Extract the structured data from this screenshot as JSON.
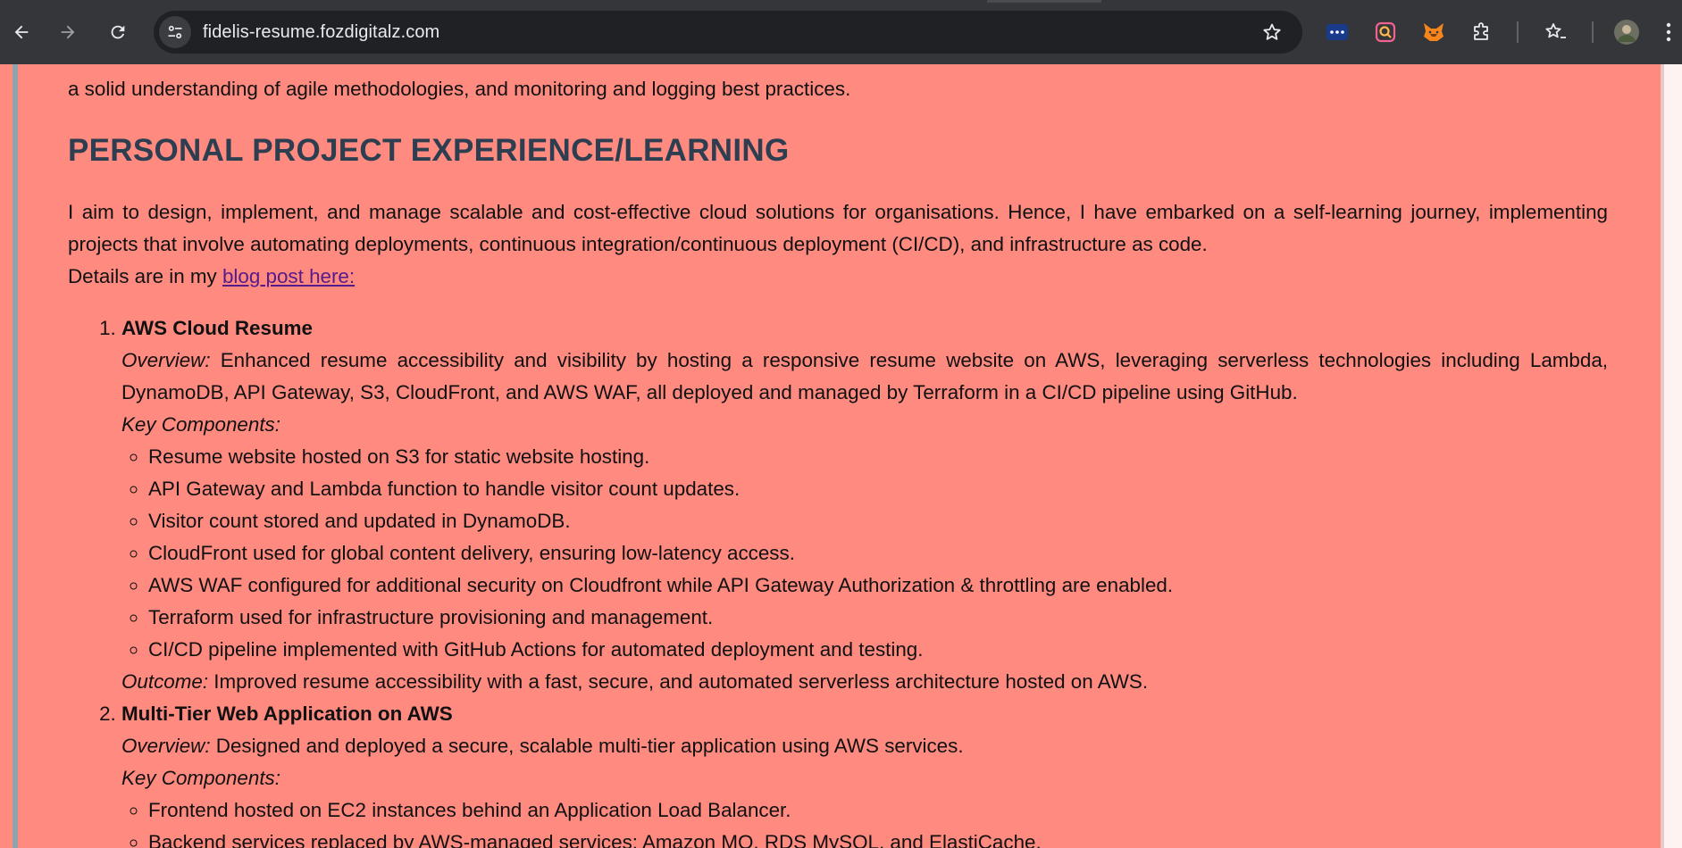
{
  "browser": {
    "url": "fidelis-resume.fozdigitalz.com",
    "nav": {
      "back_icon": "arrow-left-icon",
      "forward_icon": "arrow-right-icon",
      "reload_icon": "reload-icon"
    },
    "extensions": [
      "password-manager-icon",
      "lens-extension-icon",
      "metamask-fox-icon",
      "puzzle-extensions-icon"
    ],
    "accent": "#35363a"
  },
  "page": {
    "background": "#ff8a80",
    "heading_color": "#2c3e50",
    "intro_tail": "a solid understanding of agile methodologies, and monitoring and logging best practices.",
    "section_title": "PERSONAL PROJECT EXPERIENCE/LEARNING",
    "section_paragraph": "I aim to design, implement, and manage scalable and cost-effective cloud solutions for organisations. Hence, I have embarked on a self-learning journey, implementing projects that involve automating deployments, continuous integration/continuous deployment (CI/CD), and infrastructure as code.",
    "details_prefix": "Details are in my ",
    "blog_link_text": "blog post here:",
    "projects": [
      {
        "title": "AWS Cloud Resume",
        "overview_label": "Overview:",
        "overview_text": " Enhanced resume accessibility and visibility by hosting a responsive resume website on AWS, leveraging serverless technologies including Lambda, DynamoDB, API Gateway, S3, CloudFront, and AWS WAF, all deployed and managed by Terraform in a CI/CD pipeline using GitHub.",
        "components_label": "Key Components:",
        "components": [
          "Resume website hosted on S3 for static website hosting.",
          "API Gateway and Lambda function to handle visitor count updates.",
          "Visitor count stored and updated in DynamoDB.",
          "CloudFront used for global content delivery, ensuring low-latency access.",
          "AWS WAF configured for additional security on Cloudfront while API Gateway Authorization & throttling are enabled.",
          "Terraform used for infrastructure provisioning and management.",
          "CI/CD pipeline implemented with GitHub Actions for automated deployment and testing."
        ],
        "outcome_label": "Outcome:",
        "outcome_text": " Improved resume accessibility with a fast, secure, and automated serverless architecture hosted on AWS."
      },
      {
        "title": "Multi-Tier Web Application on AWS",
        "overview_label": "Overview:",
        "overview_text": " Designed and deployed a secure, scalable multi-tier application using AWS services.",
        "components_label": "Key Components:",
        "components": [
          "Frontend hosted on EC2 instances behind an Application Load Balancer.",
          "Backend services replaced by AWS-managed services: Amazon MQ, RDS MySQL, and ElastiCache."
        ]
      }
    ]
  }
}
